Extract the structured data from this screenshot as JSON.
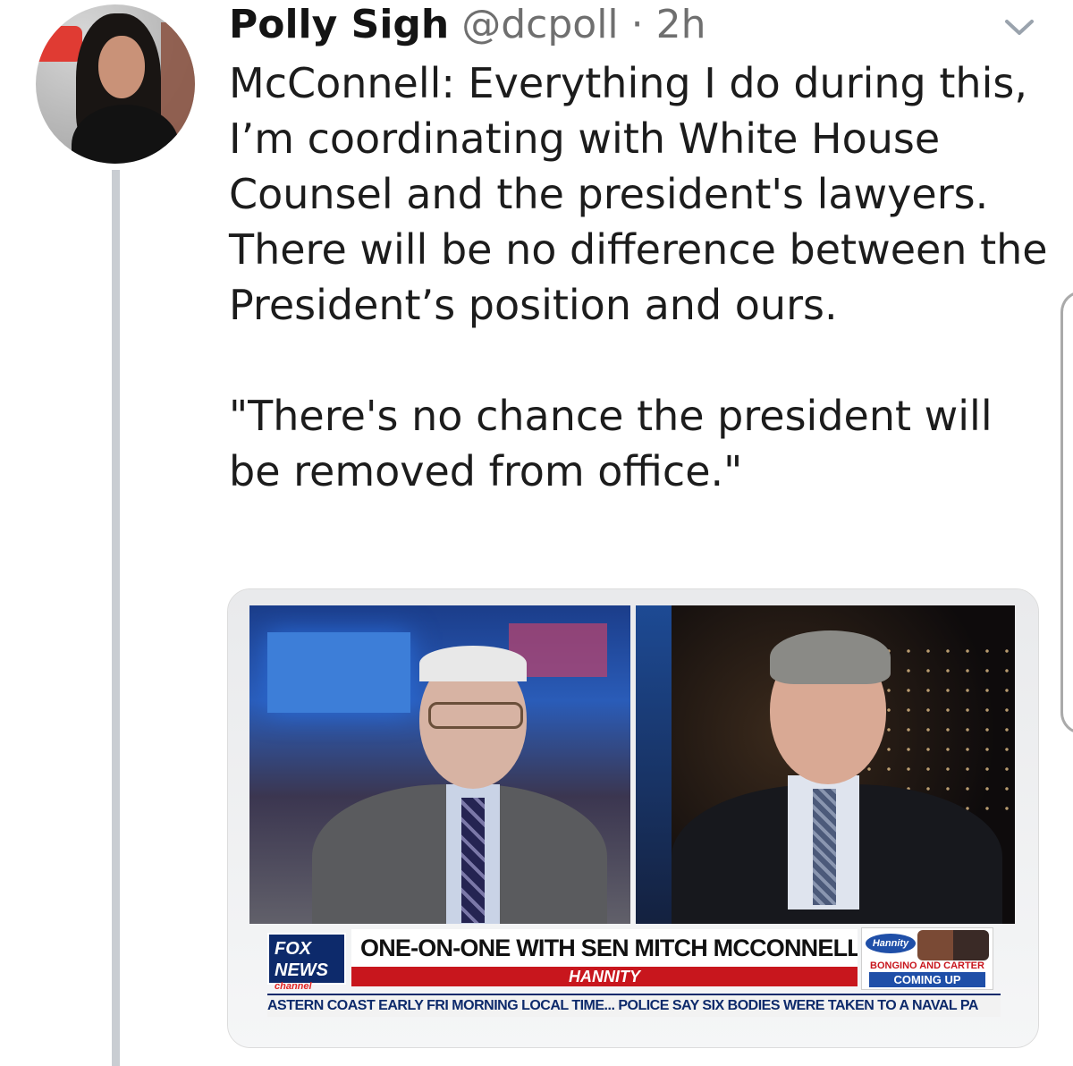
{
  "tweet": {
    "author_name": "Polly Sigh",
    "author_handle": "@dcpoll",
    "separator": "·",
    "timestamp": "2h",
    "text": "McConnell: Everything I do during this, I’m coordinating with White House Counsel and the president's lawyers. There will be no difference between the President’s position and ours.\n\n\"There's no chance the president will be removed from office.\""
  },
  "media": {
    "network_logo": "FOX NEWS",
    "network_logo_sub": "channel",
    "headline": "ONE-ON-ONE WITH SEN MITCH MCCONNELL",
    "show_name": "HANNITY",
    "promo_badge": "Hannity",
    "promo_line": "BONGINO AND CARTER",
    "promo_next": "COMING UP",
    "ticker": "ASTERN COAST EARLY FRI MORNING LOCAL TIME...   POLICE SAY SIX BODIES WERE TAKEN TO A NAVAL PA"
  },
  "icons": {
    "menu": "chevron-down-icon"
  },
  "colors": {
    "thread_line": "#c9cdd2",
    "handle_gray": "#6f6f6f",
    "fox_blue": "#0d2a6b",
    "fox_red": "#c8161d"
  }
}
